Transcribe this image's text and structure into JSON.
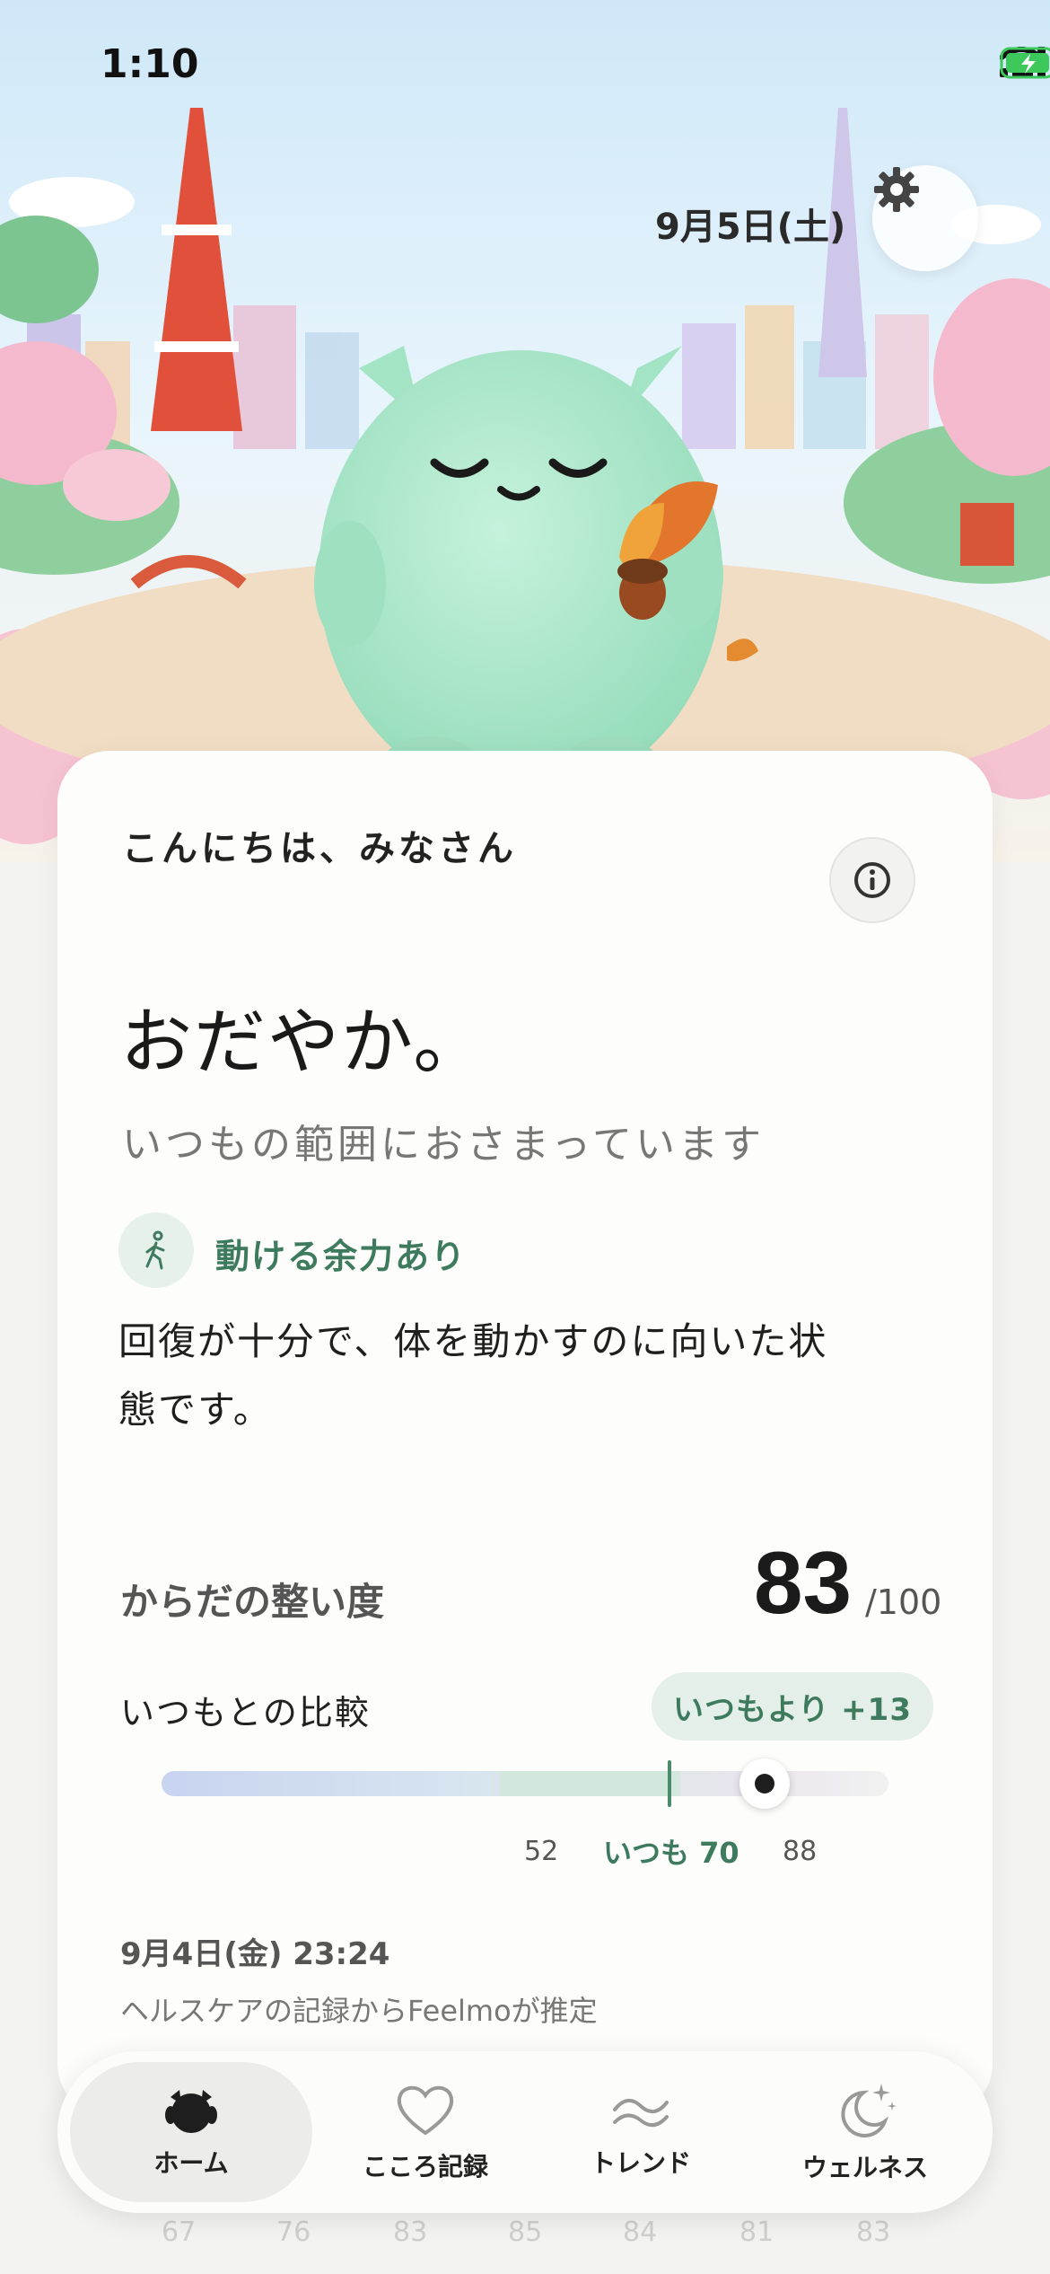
{
  "status_bar": {
    "time": "1:10"
  },
  "header": {
    "date": "9月5日(土)"
  },
  "card": {
    "greeting": "こんにちは、みなさん",
    "mood_title": "おだやか。",
    "mood_subtitle": "いつもの範囲におさまっています",
    "capacity_label": "動ける余力あり",
    "capacity_desc": "回復が十分で、体を動かすのに向いた状態です。",
    "score_label": "からだの整い度",
    "score_value": "83",
    "score_max": "/100",
    "compare_label": "いつもとの比較",
    "compare_badge": "いつもより +13",
    "range": {
      "low": "52",
      "usual_label": "いつも 70",
      "high": "88",
      "current_fraction": 0.83
    },
    "record_date": "9月4日(金) 23:24",
    "record_source": "ヘルスケアの記録からFeelmoが推定"
  },
  "faded_values": [
    "67",
    "76",
    "83",
    "85",
    "84",
    "81",
    "83"
  ],
  "nav": {
    "items": [
      {
        "label": "ホーム",
        "icon": "character-icon",
        "active": true
      },
      {
        "label": "こころ記録",
        "icon": "heart-icon",
        "active": false
      },
      {
        "label": "トレンド",
        "icon": "wave-icon",
        "active": false
      },
      {
        "label": "ウェルネス",
        "icon": "moon-sparkle-icon",
        "active": false
      }
    ]
  },
  "colors": {
    "accent_green": "#3e7a5e",
    "mascot": "#a8e6c8"
  }
}
